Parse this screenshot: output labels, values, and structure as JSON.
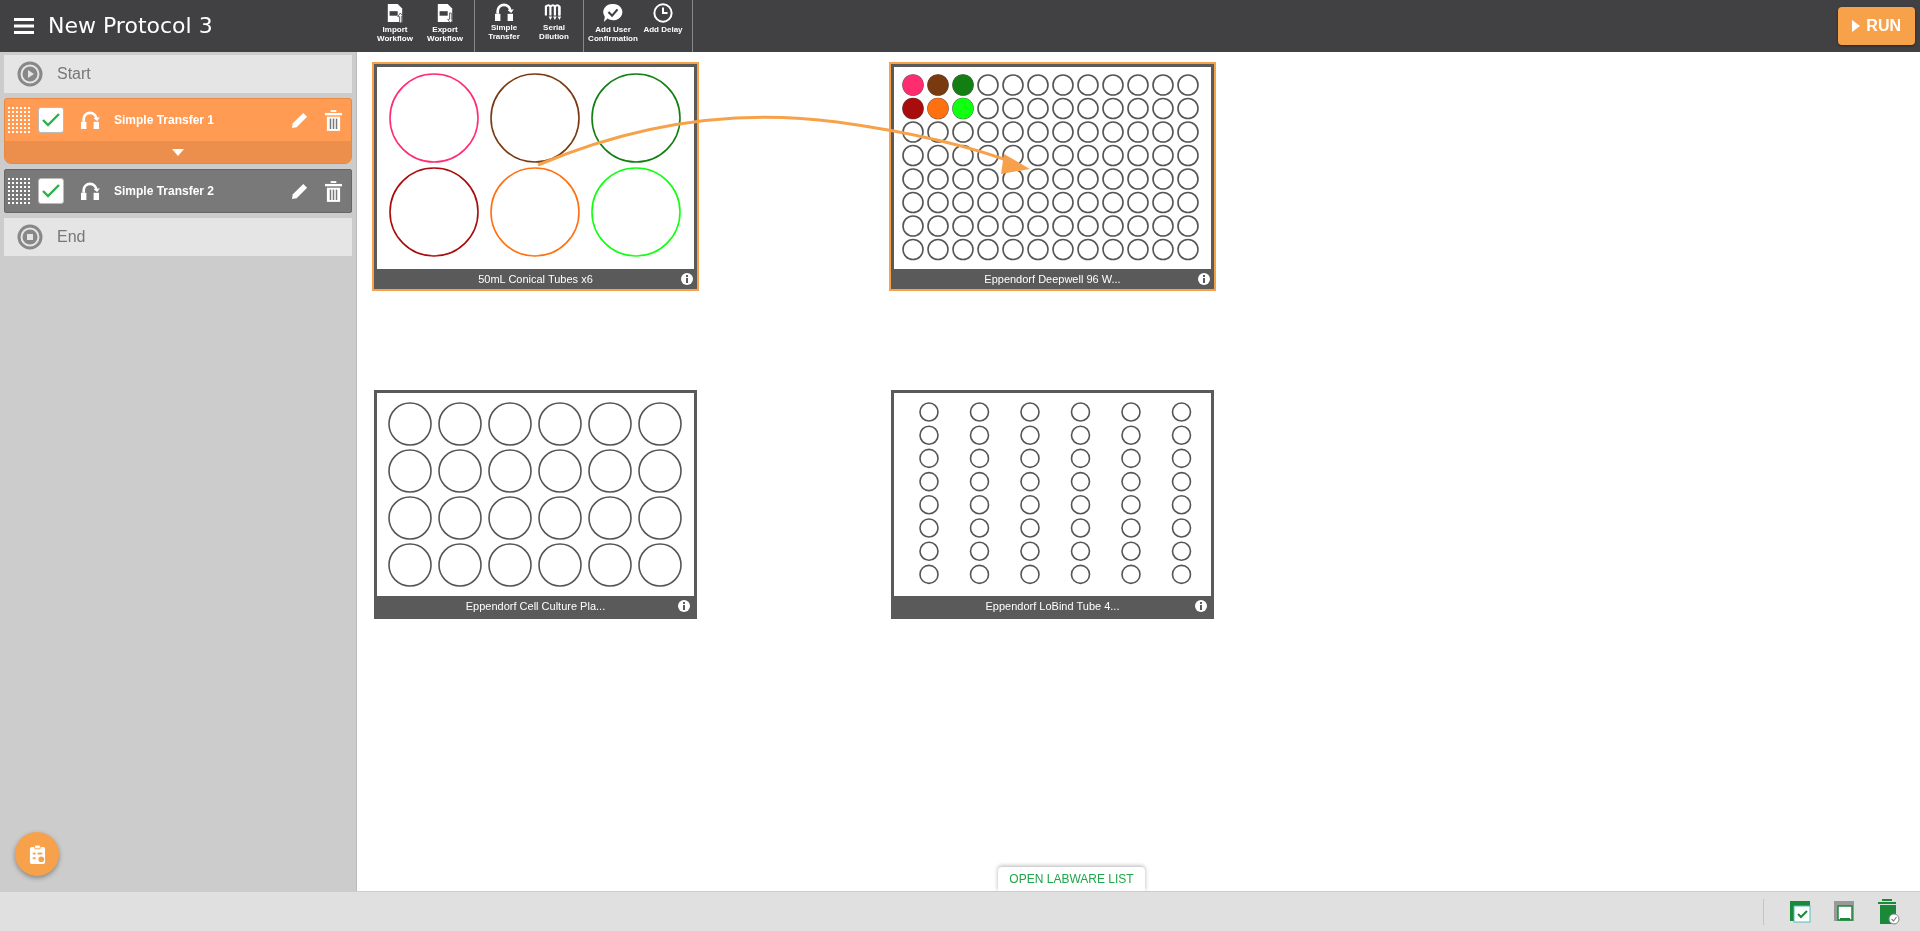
{
  "window": {
    "title": "New Protocol 3"
  },
  "toolbar": {
    "groups": [
      [
        {
          "kind": "import",
          "label": "Import Workflow"
        },
        {
          "kind": "export",
          "label": "Export Workflow"
        }
      ],
      [
        {
          "kind": "transfer",
          "label": "Simple Transfer"
        },
        {
          "kind": "dilution",
          "label": "Serial Dilution"
        }
      ],
      [
        {
          "kind": "confirm",
          "label": "Add User Confirmation"
        },
        {
          "kind": "delay",
          "label": "Add Delay"
        }
      ]
    ]
  },
  "run_button": {
    "label": "RUN"
  },
  "steps": [
    {
      "kind": "start",
      "label": "Start"
    },
    {
      "kind": "transfer",
      "label": "Simple Transfer 1",
      "selected": true,
      "checked": true
    },
    {
      "kind": "transfer",
      "label": "Simple Transfer 2",
      "selected": false,
      "checked": true
    },
    {
      "kind": "end",
      "label": "End"
    }
  ],
  "labware": [
    {
      "kind": "tubes6",
      "name": "50mL Conical Tubes x6",
      "selected": true,
      "tubes": [
        {
          "color": "#ff2d6f"
        },
        {
          "color": "#7a3a10"
        },
        {
          "color": "#137f13"
        },
        {
          "color": "#a80c0c"
        },
        {
          "color": "#ff7010"
        },
        {
          "color": "#11ff11"
        }
      ]
    },
    {
      "kind": "plate96",
      "name": "Eppendorf Deepwell 96 W...",
      "selected": true,
      "filled_wells": [
        [
          {
            "color": "#ff2d6f"
          },
          {
            "color": "#7a3a10"
          },
          {
            "color": "#137f13"
          }
        ],
        [
          {
            "color": "#a80c0c"
          },
          {
            "color": "#ff7010"
          },
          {
            "color": "#11ff11"
          }
        ]
      ]
    },
    {
      "kind": "plate24",
      "name": "Eppendorf Cell Culture Pla...",
      "selected": false
    },
    {
      "kind": "rack48",
      "name": "Eppendorf LoBind Tube 4...",
      "selected": false
    }
  ],
  "labware_list_tab": {
    "label": "OPEN LABWARE LIST"
  }
}
